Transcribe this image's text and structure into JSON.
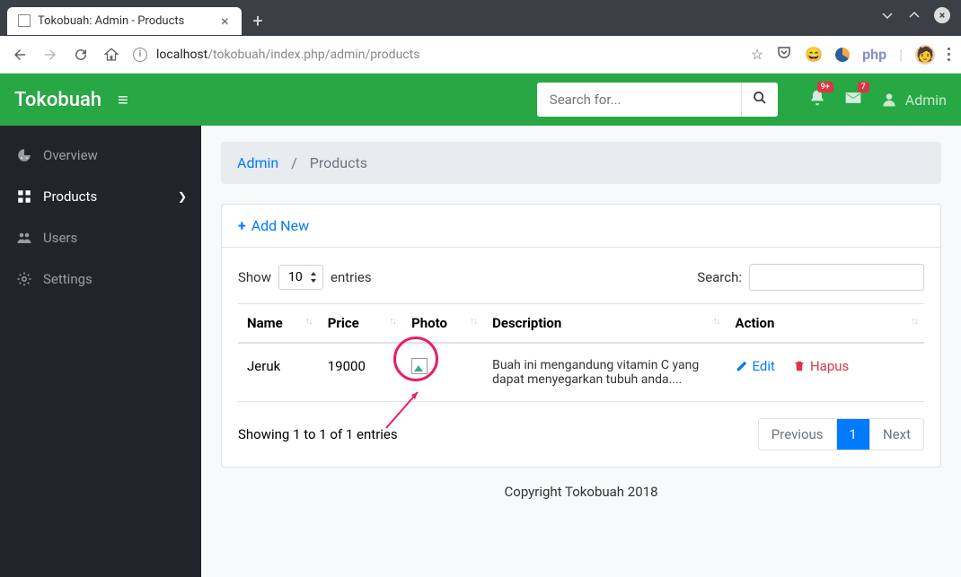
{
  "window": {
    "tab_title": "Tokobuah: Admin - Products",
    "url_domain": "localhost",
    "url_path": "/tokobuah/index.php/admin/products",
    "ext_php": "php"
  },
  "header": {
    "brand": "Tokobuah",
    "search_placeholder": "Search for...",
    "badge_bell": "9+",
    "badge_mail": "7",
    "user_label": "Admin"
  },
  "sidebar": {
    "items": [
      {
        "label": "Overview"
      },
      {
        "label": "Products"
      },
      {
        "label": "Users"
      },
      {
        "label": "Settings"
      }
    ]
  },
  "breadcrumb": {
    "root": "Admin",
    "current": "Products"
  },
  "card": {
    "add_new": "Add New",
    "show_label": "Show",
    "entries_label": "entries",
    "entries_value": "10",
    "search_label": "Search:",
    "columns": {
      "name": "Name",
      "price": "Price",
      "photo": "Photo",
      "description": "Description",
      "action": "Action"
    },
    "rows": [
      {
        "name": "Jeruk",
        "price": "19000",
        "description": "Buah ini mengandung vitamin C yang dapat menyegarkan tubuh anda....",
        "edit_label": "Edit",
        "delete_label": "Hapus"
      }
    ],
    "info_text": "Showing 1 to 1 of 1 entries",
    "pagination": {
      "prev": "Previous",
      "page": "1",
      "next": "Next"
    }
  },
  "footer": {
    "text": "Copyright Tokobuah 2018"
  }
}
